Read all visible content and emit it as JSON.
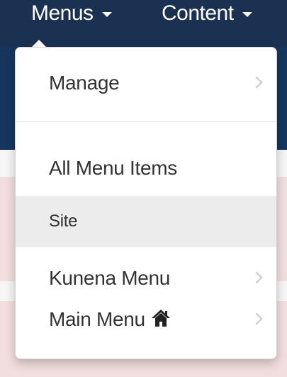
{
  "nav": {
    "items": [
      {
        "label": "Menus"
      },
      {
        "label": "Content"
      }
    ]
  },
  "dropdown": {
    "items": [
      {
        "label": "Manage",
        "has_submenu": true,
        "icon": "chevron-right-icon"
      },
      {
        "label": "All Menu Items",
        "has_submenu": false
      },
      {
        "label": "Site",
        "has_submenu": false,
        "highlighted": true
      },
      {
        "label": "Kunena Menu",
        "has_submenu": true,
        "icon": "chevron-right-icon"
      },
      {
        "label": "Main Menu",
        "has_submenu": true,
        "home_icon": "home-icon",
        "icon": "chevron-right-icon"
      }
    ]
  },
  "colors": {
    "topbar": "#1a3152",
    "subheader": "#17365d",
    "pink_band": "#f2dede",
    "highlight": "#ececec",
    "text": "#333333"
  }
}
